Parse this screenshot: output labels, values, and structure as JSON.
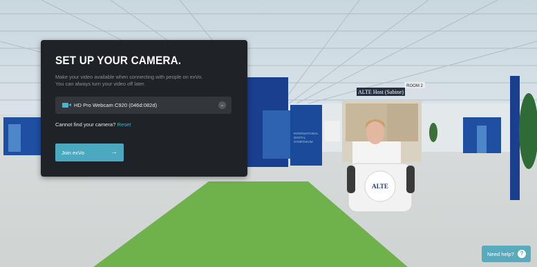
{
  "setup": {
    "title": "SET UP YOUR CAMERA.",
    "description_line1": "Make your video available when connecting with people on exVo.",
    "description_line2": "You can always turn your video off later.",
    "camera_select_value": "HD Pro Webcam C920 (046d:082d)",
    "cannot_find": "Cannot find your camera?",
    "reset_link": "Reset",
    "join_button": "Join exVo",
    "join_arrow": "→"
  },
  "scene": {
    "room_sign": "ROOM 2",
    "host_sign": "ALTE Host (Sabine)",
    "podium_logo": "ALTE",
    "booth_line1": "INTERNATIONAL",
    "booth_line2": "DIGITAL",
    "booth_line3": "SYMPOSIUM"
  },
  "help": {
    "label": "Need help?",
    "icon_glyph": "?"
  },
  "colors": {
    "accent": "#4aa8bf",
    "panel_bg": "#1f2226",
    "carpet": "#6fb24c"
  }
}
